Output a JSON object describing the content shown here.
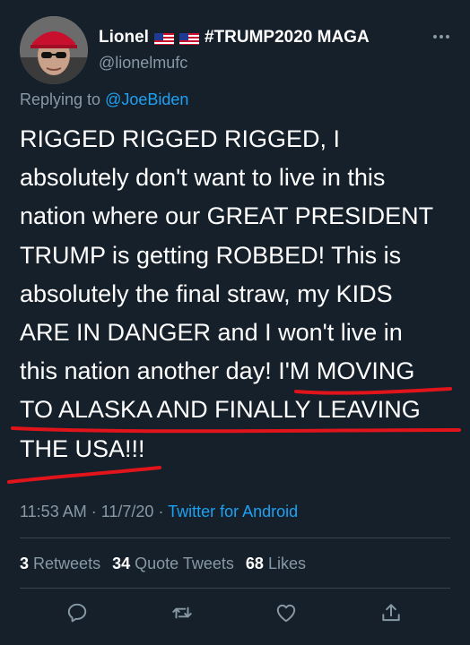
{
  "author": {
    "display_name": "Lionel",
    "name_suffix": "#TRUMP2020 MAGA",
    "handle": "@lionelmufc",
    "flag_icons": [
      "us-flag-icon",
      "us-flag-icon"
    ]
  },
  "more_icon": "more-horizontal-icon",
  "reply": {
    "prefix": "Replying to ",
    "mention": "@JoeBiden"
  },
  "tweet": {
    "text": "RIGGED RIGGED RIGGED, I absolutely don't want to live in this nation where our GREAT PRESIDENT TRUMP is getting ROBBED! This is absolutely the final straw, my KIDS ARE IN DANGER and I won't live in this nation another day! I'M MOVING TO ALASKA AND FINALLY LEAVING THE USA!!!",
    "lines": [
      "RIGGED RIGGED RIGGED, I",
      "absolutely don't want to live in this",
      "nation where our GREAT PRESIDENT",
      "TRUMP is getting ROBBED! This is",
      "absolutely the final straw, my KIDS",
      "ARE IN DANGER and I won't live in",
      "this nation another day! I'M MOVING",
      "TO ALASKA AND FINALLY LEAVING",
      "THE USA!!!"
    ]
  },
  "meta": {
    "time": "11:53 AM",
    "separator": " · ",
    "date": "11/7/20",
    "client": "Twitter for Android"
  },
  "stats": {
    "retweets_count": "3",
    "retweets_label": "Retweets",
    "quotes_count": "34",
    "quotes_label": "Quote Tweets",
    "likes_count": "68",
    "likes_label": "Likes"
  },
  "actions": [
    "reply-icon",
    "retweet-icon",
    "like-icon",
    "share-icon"
  ],
  "colors": {
    "background": "#15202b",
    "text": "#ffffff",
    "secondary": "#8899a6",
    "link": "#1da1f2",
    "divider": "#38444d",
    "annotation": "#e0141a"
  }
}
